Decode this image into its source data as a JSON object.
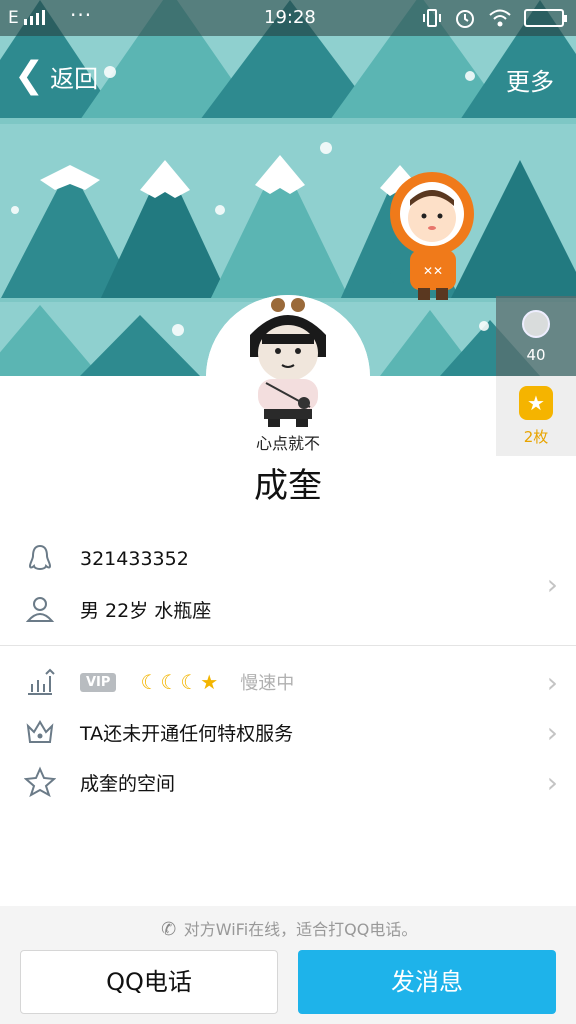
{
  "status_bar": {
    "carrier": "E",
    "overflow": "···",
    "time": "19:28"
  },
  "nav": {
    "back_label": "返回",
    "more_label": "更多"
  },
  "side_rail": {
    "flowers_count": "40",
    "medals_count": "2枚"
  },
  "profile": {
    "nickname": "成奎",
    "avatar_caption": "心点就不"
  },
  "info": {
    "qq_number": "321433352",
    "demographics": "男   22岁   水瓶座",
    "vip_badge": "VIP",
    "vip_level": "☾☾☾★",
    "vip_speed": "慢速中",
    "privilege_text": "TA还未开通任何特权服务",
    "zone_text": "成奎的空间"
  },
  "bottom": {
    "wifi_tip": "对方WiFi在线，适合打QQ电话。",
    "call_button": "QQ电话",
    "message_button": "发消息"
  },
  "colors": {
    "accent": "#1eb3ea",
    "cover_bg": "#8fd0cf",
    "tree_dark": "#2e8a8f",
    "tree_mid": "#5bb5b3",
    "vip_gold": "#f3b500"
  }
}
